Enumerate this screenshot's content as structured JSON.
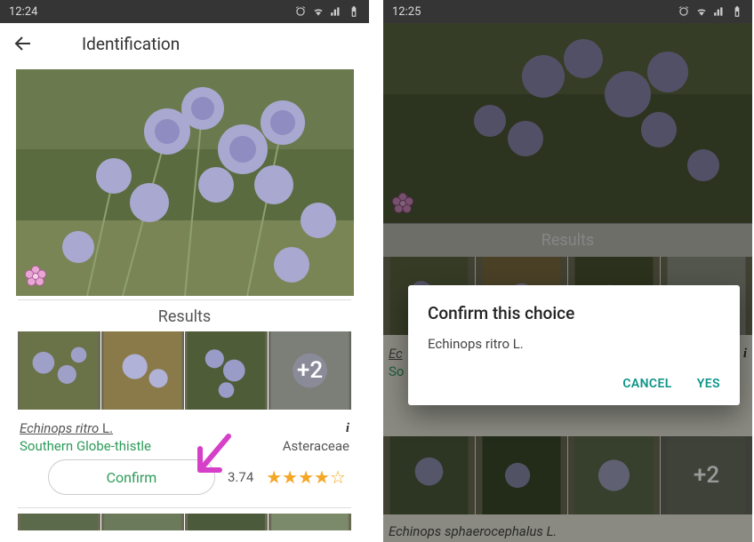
{
  "left": {
    "status": {
      "time": "12:24"
    },
    "appbar": {
      "title": "Identification"
    },
    "results_heading": "Results",
    "more_count": "+2",
    "species": {
      "latin": "Echinops ritro",
      "author": " L.",
      "common": "Southern Globe-thistle",
      "family": "Asteraceae"
    },
    "confirm_label": "Confirm",
    "score": "3.74",
    "stars": {
      "full": "★★★★",
      "empty": "☆"
    }
  },
  "right": {
    "status": {
      "time": "12:25"
    },
    "results_heading": "Results",
    "more_count": "+2",
    "species_partial": {
      "latin_prefix": "Ec",
      "common_prefix": "So"
    },
    "species2": "Echinops sphaerocephalus L.",
    "dialog": {
      "title": "Confirm this choice",
      "body": "Echinops ritro L.",
      "cancel": "CANCEL",
      "yes": "YES"
    }
  }
}
